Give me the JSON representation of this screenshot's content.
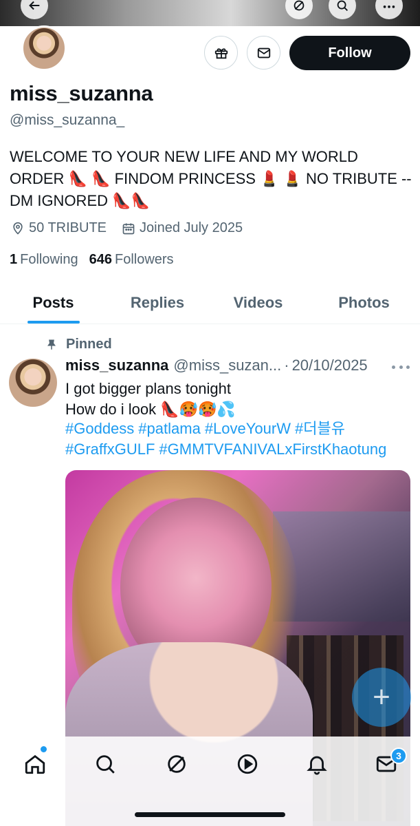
{
  "profile": {
    "display_name": "miss_suzanna",
    "handle": "@miss_suzanna_",
    "bio": "WELCOME TO YOUR NEW LIFE AND MY WORLD ORDER 👠 👠 FINDOM PRINCESS 💄 💄 NO TRIBUTE --DM IGNORED 👠👠",
    "location": "50 TRIBUTE",
    "joined": "Joined July 2025",
    "following_count": "1",
    "following_label": "Following",
    "followers_count": "646",
    "followers_label": "Followers",
    "follow_label": "Follow"
  },
  "tabs": [
    {
      "label": "Posts",
      "active": true
    },
    {
      "label": "Replies",
      "active": false
    },
    {
      "label": "Videos",
      "active": false
    },
    {
      "label": "Photos",
      "active": false
    }
  ],
  "post": {
    "pinned_label": "Pinned",
    "author_name": "miss_suzanna",
    "author_handle": "@miss_suzan...",
    "separator": "·",
    "date": "20/10/2025",
    "text_line1": "I got bigger plans tonight",
    "text_line2": "How do i look 👠🥵🥵💦",
    "hashtags": [
      "#Goddess",
      "#patlama",
      "#LoveYourW",
      "#더블유",
      "#GraffxGULF",
      "#GMMTVFANIVALxFirstKhaotung"
    ]
  },
  "fab": {
    "label": "+"
  },
  "nav": {
    "items": [
      "home-icon",
      "search-icon",
      "grok-icon",
      "video-icon",
      "notifications-icon",
      "messages-icon"
    ],
    "messages_badge": "3"
  },
  "colors": {
    "accent": "#1d9bf0",
    "text_primary": "#0f1419",
    "text_secondary": "#536471",
    "follow_bg": "#0f1419"
  }
}
